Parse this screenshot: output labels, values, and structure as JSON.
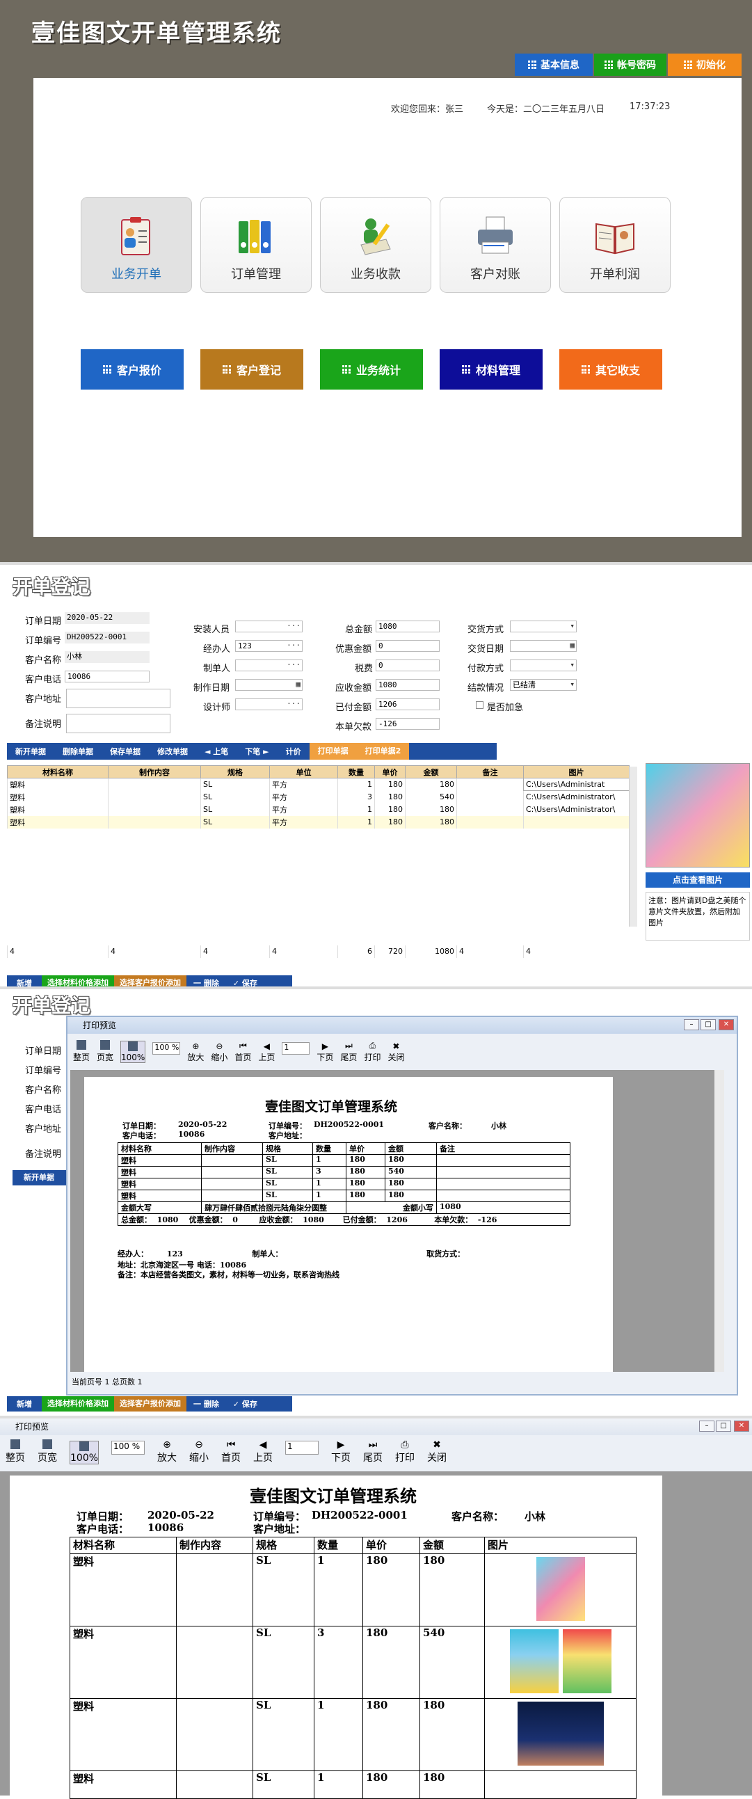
{
  "home": {
    "title": "壹佳图文开单管理系统",
    "top_buttons": [
      {
        "label": "基本信息",
        "color": "#1f66c6"
      },
      {
        "label": "帐号密码",
        "color": "#1aa01a"
      },
      {
        "label": "初始化",
        "color": "#f28a1a"
      }
    ],
    "welcome_label": "欢迎您回来：张三",
    "today_label": "今天是：二〇二三年五月八日",
    "time": "17:37:23",
    "modules": [
      {
        "label": "业务开单",
        "icon": "clipboard-user-icon"
      },
      {
        "label": "订单管理",
        "icon": "binders-icon"
      },
      {
        "label": "业务收款",
        "icon": "person-pencil-icon"
      },
      {
        "label": "客户对账",
        "icon": "printer-icon"
      },
      {
        "label": "开单利润",
        "icon": "open-book-icon"
      }
    ],
    "color_buttons": [
      {
        "label": "客户报价",
        "color": "#1f66c6"
      },
      {
        "label": "客户登记",
        "color": "#b8791e"
      },
      {
        "label": "业务统计",
        "color": "#1aa51a"
      },
      {
        "label": "材料管理",
        "color": "#0d0d99"
      },
      {
        "label": "其它收支",
        "color": "#f26a1a"
      }
    ]
  },
  "form": {
    "section_title": "开单登记",
    "labels": {
      "order_date": "订单日期",
      "order_no": "订单编号",
      "customer_name": "客户名称",
      "customer_phone": "客户电话",
      "customer_addr": "客户地址",
      "remark": "备注说明",
      "installer": "安装人员",
      "handler": "经办人",
      "maker": "制单人",
      "make_date": "制作日期",
      "designer": "设计师",
      "total": "总金额",
      "discount": "优惠金额",
      "tax": "税费",
      "receivable": "应收金额",
      "paid": "已付金额",
      "owed": "本单欠款",
      "delivery_method": "交货方式",
      "delivery_date": "交货日期",
      "pay_method": "付款方式",
      "settle": "结款情况",
      "urgent": "是否加急"
    },
    "values": {
      "order_date": "2020-05-22",
      "order_no": "DH200522-0001",
      "customer_name": "小林",
      "customer_phone": "10086",
      "handler": "123",
      "total": "1080",
      "discount": "0",
      "tax": "0",
      "receivable": "1080",
      "paid": "1206",
      "owed": "-126",
      "settle": "已结清"
    },
    "toolbar": [
      "新开单据",
      "删除单据",
      "保存单据",
      "修改单据",
      "◄ 上笔",
      "下笔 ►",
      "计价",
      "打印单据",
      "打印单据2"
    ],
    "columns": [
      "材料名称",
      "制作内容",
      "规格",
      "单位",
      "数量",
      "单价",
      "金额",
      "备注",
      "图片"
    ],
    "rows": [
      [
        "塑料",
        "",
        "SL",
        "平方",
        "1",
        "180",
        "180",
        "",
        "C:\\Users\\Administrat"
      ],
      [
        "塑料",
        "",
        "SL",
        "平方",
        "3",
        "180",
        "540",
        "",
        "C:\\Users\\Administrator\\"
      ],
      [
        "塑料",
        "",
        "SL",
        "平方",
        "1",
        "180",
        "180",
        "",
        "C:\\Users\\Administrator\\"
      ],
      [
        "塑料",
        "",
        "SL",
        "平方",
        "1",
        "180",
        "180",
        "",
        ""
      ]
    ],
    "footer": [
      "4",
      "4",
      "4",
      "4",
      "6",
      "720",
      "1080",
      "4",
      "4"
    ],
    "bottom_buttons": [
      "新增",
      "选择材料价格添加",
      "选择客户报价添加",
      "一 删除",
      "✓ 保存"
    ],
    "view_image_btn": "点击查看图片",
    "note": "注意：图片请到D盘之美随个意片文件夹放置，然后附加图片"
  },
  "preview": {
    "window_title": "打印预览",
    "tools": [
      "整页",
      "页宽",
      "100%",
      "100 %",
      "放大",
      "缩小",
      "首页",
      "上页",
      "1",
      "下页",
      "尾页",
      "打印",
      "关闭"
    ],
    "status": "当前页号 1  总页数 1",
    "doc_title": "壹佳图文订单管理系统",
    "h_order_date": "订单日期：",
    "v_order_date": "2020-05-22",
    "h_order_no": "订单编号：",
    "v_order_no": "DH200522-0001",
    "h_customer": "客户名称：",
    "v_customer": "小林",
    "h_phone": "客户电话：",
    "v_phone": "10086",
    "h_addr": "客户地址：",
    "cols": [
      "材料名称",
      "制作内容",
      "规格",
      "数量",
      "单价",
      "金额",
      "备注"
    ],
    "cols_img": [
      "材料名称",
      "制作内容",
      "规格",
      "数量",
      "单价",
      "金额",
      "图片"
    ],
    "rows": [
      [
        "塑料",
        "",
        "SL",
        "1",
        "180",
        "180",
        ""
      ],
      [
        "塑料",
        "",
        "SL",
        "3",
        "180",
        "540",
        ""
      ],
      [
        "塑料",
        "",
        "SL",
        "1",
        "180",
        "180",
        ""
      ],
      [
        "塑料",
        "",
        "SL",
        "1",
        "180",
        "180",
        ""
      ]
    ],
    "big_label": "金额大写",
    "big_value": "肆万肆仟肆佰贰拾捌元陆角柒分圆整",
    "small_label": "金额小写",
    "small_value": "1080",
    "sum_line": "总金额：  1080    优惠金额：  0        应收金额：  1080       已付金额：  1206          本单欠款：  -126",
    "handler_line": "经办人：       123                          制单人：                                                      取货方式：",
    "addr_line": "地址：北京海淀区一号   电话：10086",
    "remark_line": "备注：本店经营各类图文，素材，材料等一切业务，联系咨询热线"
  }
}
